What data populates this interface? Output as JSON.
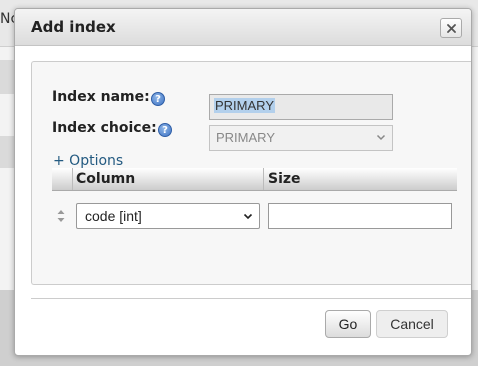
{
  "background": {
    "partial_text": "Nc"
  },
  "dialog": {
    "title": "Add index",
    "close_label": "×"
  },
  "form": {
    "index_name_label": "Index name:",
    "index_name_value": "PRIMARY",
    "index_choice_label": "Index choice:",
    "index_choice_value": "PRIMARY",
    "options_link": "+ Options"
  },
  "columns_table": {
    "headers": [
      "Column",
      "Size"
    ],
    "row": {
      "column_value": "code [int]",
      "size_value": ""
    }
  },
  "buttons": {
    "go": "Go",
    "cancel": "Cancel"
  },
  "icons": {
    "help": "help-icon",
    "close": "close-icon",
    "chevron": "chevron-down-icon",
    "drag": "drag-handle-icon"
  },
  "colors": {
    "link": "#235a81",
    "selection": "#b3d0ec"
  }
}
